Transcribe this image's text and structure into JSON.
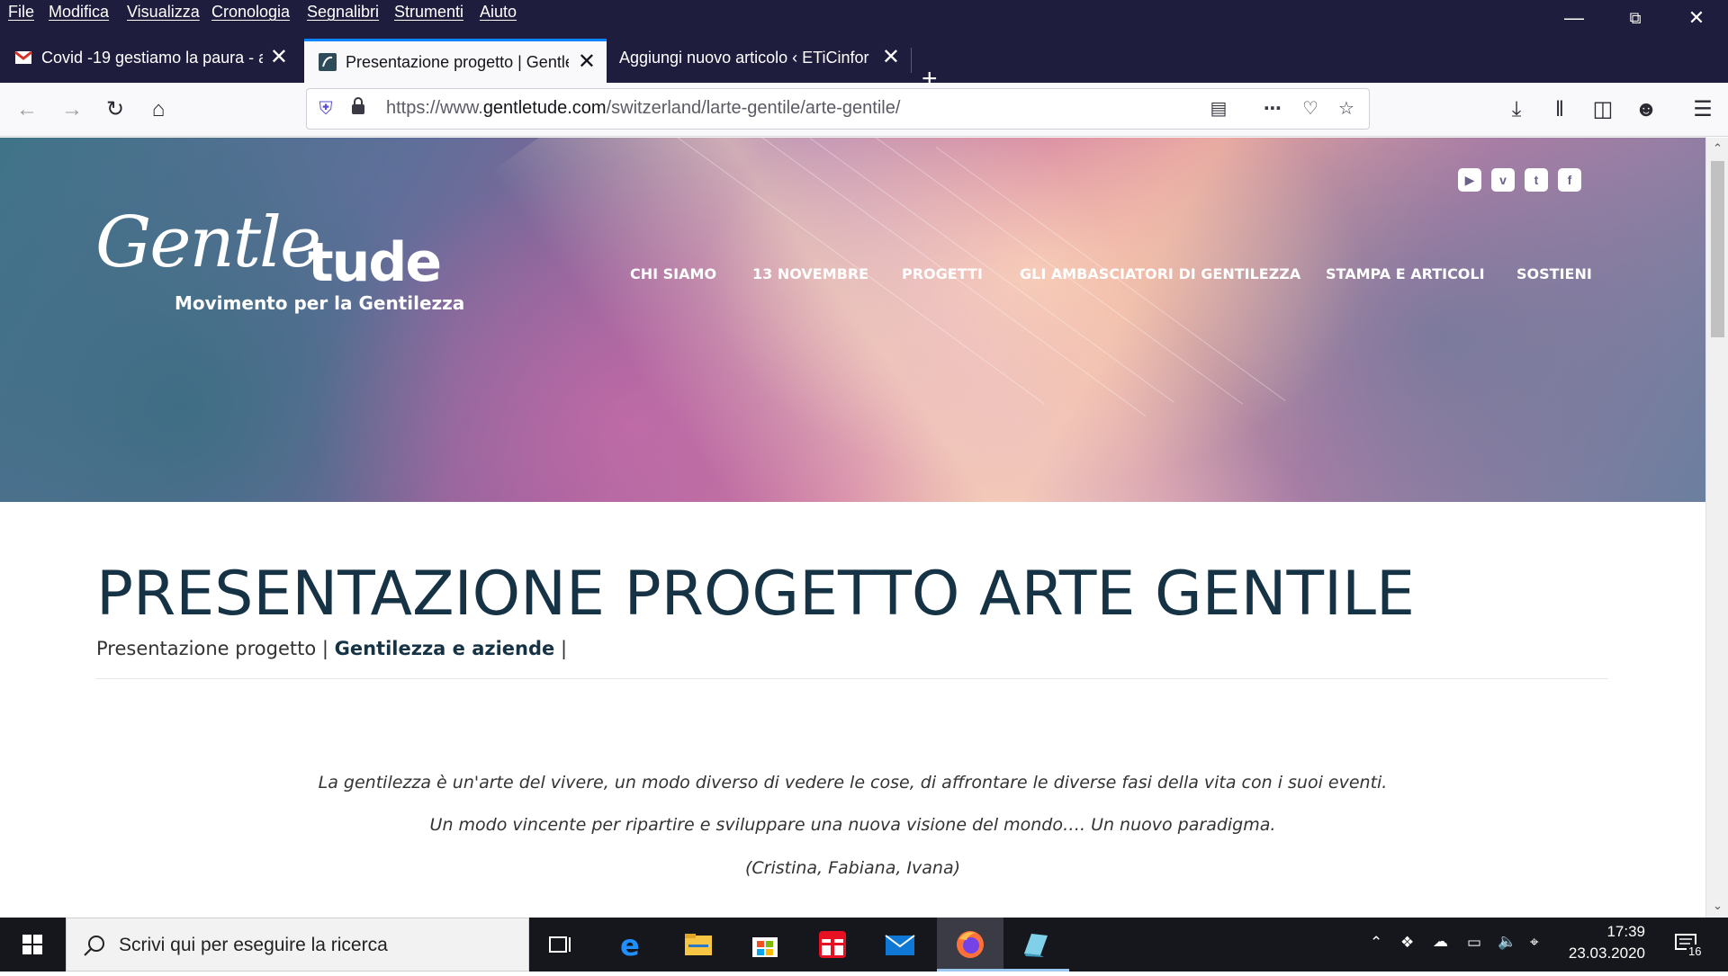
{
  "menubar": {
    "items": [
      "File",
      "Modifica",
      "Visualizza",
      "Cronologia",
      "Segnalibri",
      "Strumenti",
      "Aiuto"
    ],
    "window_controls": [
      "minimize",
      "restore",
      "close"
    ]
  },
  "tabs": [
    {
      "title": "Covid -19 gestiamo la paura - a",
      "favicon": "gmail-icon",
      "active": false
    },
    {
      "title": "Presentazione progetto | Gentle",
      "favicon": "gentletude-icon",
      "active": true
    },
    {
      "title": "Aggiungi nuovo articolo ‹ ETiCinfor",
      "favicon": "",
      "active": false
    }
  ],
  "navbar": {
    "url_prefix": "https://www.",
    "url_host": "gentletude.com",
    "url_path": "/switzerland/larte-gentile/arte-gentile/"
  },
  "site": {
    "logo_script": "Gentle",
    "logo_bold": "tude",
    "logo_tagline": "Movimento per la Gentilezza",
    "social": [
      "youtube-icon",
      "vimeo-icon",
      "twitter-icon",
      "facebook-icon"
    ],
    "nav": [
      "CHI SIAMO",
      "13 NOVEMBRE",
      "PROGETTI",
      "GLI AMBASCIATORI DI GENTILEZZA",
      "STAMPA E ARTICOLI",
      "SOSTIENI"
    ]
  },
  "content": {
    "title": "PRESENTAZIONE PROGETTO ARTE GENTILE",
    "breadcrumb_plain": "Presentazione progetto | ",
    "breadcrumb_bold": "Gentilezza e aziende",
    "breadcrumb_end": " |",
    "quote_lines": [
      "La gentilezza è un'arte del vivere, un modo diverso di vedere le cose, di affrontare le diverse fasi della vita con i suoi eventi.",
      "Un modo vincente per ripartire e sviluppare una nuova visione del mondo…. Un nuovo paradigma.",
      "(Cristina, Fabiana, Ivana)"
    ]
  },
  "taskbar": {
    "search_placeholder": "Scrivi qui per eseguire la ricerca",
    "time": "17:39",
    "date": "23.03.2020",
    "notification_count": "16"
  }
}
